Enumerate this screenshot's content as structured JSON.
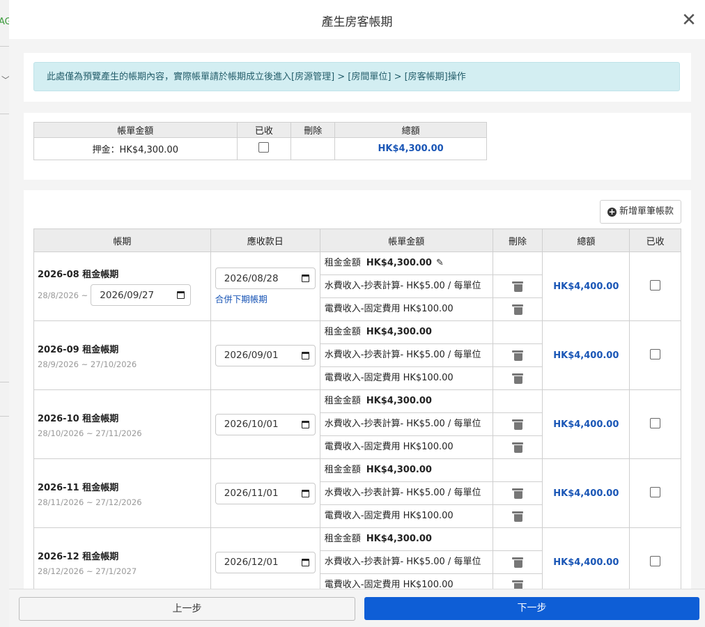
{
  "modal": {
    "title": "產生房客帳期",
    "close_glyph": "✕"
  },
  "background": {
    "fragment_text": "AG"
  },
  "notice": "此處僅為預覽產生的帳期內容，實際帳單請於帳期成立後進入[房源管理] > [房間單位] > [房客帳期]操作",
  "deposit_table": {
    "headers": [
      "帳單金額",
      "已收",
      "刪除",
      "總額"
    ],
    "row": {
      "amount": "押金：HK$4,300.00",
      "total": "HK$4,300.00"
    }
  },
  "add_button_label": "新增單筆帳款",
  "main_table": {
    "headers": [
      "帳期",
      "應收款日",
      "帳單金額",
      "刪除",
      "總額",
      "已收"
    ],
    "rows": [
      {
        "title": "2026-08 租金帳期",
        "range_start": "28/8/2026 ~",
        "range_end_input": "2026/09/27",
        "due_date": "2026/08/28",
        "merge_link": "合併下期帳期",
        "rent_label": "租金金額",
        "rent_amount": "HK$4,300.00",
        "water": "水費收入-抄表計算- HK$5.00 / 每單位",
        "electric": "電費收入-固定費用 HK$100.00",
        "total": "HK$4,400.00"
      },
      {
        "title": "2026-09 租金帳期",
        "range": "28/9/2026 ~ 27/10/2026",
        "due_date": "2026/09/01",
        "rent_label": "租金金額",
        "rent_amount": "HK$4,300.00",
        "water": "水費收入-抄表計算- HK$5.00 / 每單位",
        "electric": "電費收入-固定費用 HK$100.00",
        "total": "HK$4,400.00"
      },
      {
        "title": "2026-10 租金帳期",
        "range": "28/10/2026 ~ 27/11/2026",
        "due_date": "2026/10/01",
        "rent_label": "租金金額",
        "rent_amount": "HK$4,300.00",
        "water": "水費收入-抄表計算- HK$5.00 / 每單位",
        "electric": "電費收入-固定費用 HK$100.00",
        "total": "HK$4,400.00"
      },
      {
        "title": "2026-11 租金帳期",
        "range": "28/11/2026 ~ 27/12/2026",
        "due_date": "2026/11/01",
        "rent_label": "租金金額",
        "rent_amount": "HK$4,300.00",
        "water": "水費收入-抄表計算- HK$5.00 / 每單位",
        "electric": "電費收入-固定費用 HK$100.00",
        "total": "HK$4,400.00"
      },
      {
        "title": "2026-12 租金帳期",
        "range": "28/12/2026 ~ 27/1/2027",
        "due_date": "2026/12/01",
        "rent_label": "租金金額",
        "rent_amount": "HK$4,300.00",
        "water": "水費收入-抄表計算- HK$5.00 / 每單位",
        "electric": "電費收入-固定費用 HK$100.00",
        "total": "HK$4,400.00"
      }
    ]
  },
  "footer": {
    "prev_label": "上一步",
    "next_label": "下一步"
  },
  "colors": {
    "primary": "#0e5ed6",
    "link": "#1a56b6",
    "alert_bg": "#d3eef2"
  },
  "icons": {
    "close": "close-icon",
    "add": "plus-circle-icon",
    "edit": "pencil-icon",
    "delete": "trash-icon",
    "calendar": "calendar-icon"
  }
}
